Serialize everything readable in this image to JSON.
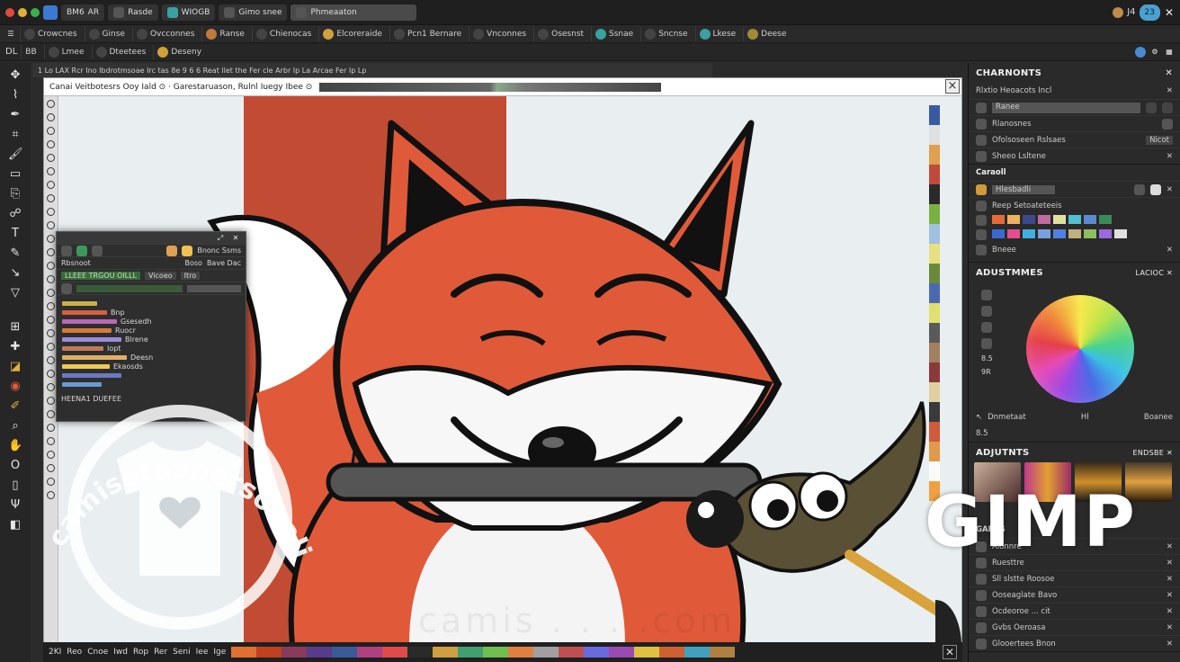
{
  "titlebar": {
    "tabs": [
      "BM6",
      "AR",
      "Rasde",
      "WIOGB",
      "Gimo snee",
      "Phmeaaton"
    ],
    "right": [
      "J4",
      "23"
    ]
  },
  "toolbar1": {
    "items": [
      "Crowcnes",
      "Ginse",
      "Ovcconnes",
      "Ranse",
      "Chienocas",
      "Elcoreraide",
      "Pcn1 Bernare",
      "Vnconnes",
      "Osesnst",
      "Ssnae",
      "Sncnse",
      "Lkese",
      "Deese"
    ]
  },
  "toolbar2": {
    "items": [
      "DL",
      "BB",
      "Lmee",
      "Dteetees",
      "Deseny"
    ]
  },
  "ruler_text": "1 Lo LAX Rcr Ino Ibdrotmsoae Irc tas 8e 9 6 6 Reat llet the Fer cle Arbr Ip La Arcae Fer Ip Lp",
  "canvas": {
    "title": "Canai Veitbotesrs Ooy Iald  ⊙ · Garestaruason, Rulnl Iuegy Ibee ⊙",
    "close": "×"
  },
  "float_dialog": {
    "row1": "Bnonc Ssms",
    "row2_left": "Rbsnoot",
    "row2_mid": "Boso",
    "row2_right": "Bave Dac",
    "row3_left": "LLEEE TRGOU OILLL",
    "row3_mid": "Vicoeo",
    "row3_right": "Itro",
    "bars": [
      {
        "label": "",
        "color": "#c9b24a",
        "w": 0.35
      },
      {
        "label": "Bnp",
        "color": "#d46040",
        "w": 0.45
      },
      {
        "label": "Gsesedh",
        "color": "#b46ab4",
        "w": 0.55
      },
      {
        "label": "Ruocr",
        "color": "#d67a3a",
        "w": 0.5
      },
      {
        "label": "Blrene",
        "color": "#9a8ad6",
        "w": 0.6
      },
      {
        "label": "Iopt",
        "color": "#c07a5a",
        "w": 0.42
      },
      {
        "label": "Deesn",
        "color": "#e0b060",
        "w": 0.65
      },
      {
        "label": "Ekaosds",
        "color": "#f0c850",
        "w": 0.48
      },
      {
        "label": "",
        "color": "#6a7ac0",
        "w": 0.6
      },
      {
        "label": "",
        "color": "#6a9ad0",
        "w": 0.4
      }
    ],
    "footer": "HEENA1 DUEFEE"
  },
  "dock": {
    "channels": {
      "title": "CHARNONTS",
      "sub": "Rlxtio Heoacots Incl",
      "rows": [
        "Rlanosnes",
        "Ofolsoseen  Rslsaes",
        "Sheeo Lsltene"
      ],
      "row1_field": "Ranee",
      "row1_extra": "Nicot"
    },
    "brushes": {
      "title": "Caraoll",
      "row1": "Hlesbadli",
      "row2": "Reep Setoateteeis",
      "row3": "Bneee",
      "swatches": [
        "#e46a3a",
        "#f0b060",
        "#3a4a8a",
        "#c06aa0",
        "#e0e0a0",
        "#50c0d0",
        "#5a8ad0",
        "#3a8a5a",
        "#2a2a2a",
        "#3a6ad0",
        "#e0508a",
        "#40b0e0",
        "#7aa0e0",
        "#5080e0",
        "#c0b080",
        "#8ac060",
        "#9a6ae0",
        "#e0e0e0"
      ]
    },
    "adjust": {
      "title": "ADUSTMMES",
      "right": "LACIOC",
      "left_values": [
        "8.5",
        "9R",
        "8.5"
      ],
      "bottom": [
        "Dnmetaat",
        "Hl",
        "Boanee"
      ]
    },
    "adjuments": {
      "title": "ADJUTNTS",
      "right": "ENDSBE",
      "label2": "GARAS",
      "rows": [
        "Alonnre",
        "Ruesttre",
        "Sll slstte Roosoe",
        "Ooseaglate Bavo",
        "Ocdeoroe ... cit",
        "Gvbs Oeroasa",
        "Glooertees Bnon"
      ]
    }
  },
  "statusbar": {
    "labels": [
      "2KI",
      "Reo",
      "Cnoe",
      "Iwd",
      "Rop",
      "Rer",
      "Seni",
      "Iee",
      "Ige"
    ],
    "swatches": [
      "#e07030",
      "#c04020",
      "#8a3a5a",
      "#5a3a8a",
      "#3a5a9a",
      "#b04080",
      "#e04a4a",
      "#2a2a2a",
      "#d0a040",
      "#40a070",
      "#70c050",
      "#e08040",
      "#a0a0a0",
      "#c05050",
      "#6a6ae0",
      "#9a4ab0",
      "#e0c040",
      "#d06030",
      "#40a0c0",
      "#b08040"
    ]
  },
  "brand": {
    "gimp": "GIMP",
    "watermark_top": "camisetaspersonalizadas.com",
    "watermark_faint": "camis . . . .com"
  },
  "colors": {
    "fox_orange": "#e05a3a",
    "fox_bg_red": "#c24b33",
    "canvas_bg": "#e9eef1"
  }
}
